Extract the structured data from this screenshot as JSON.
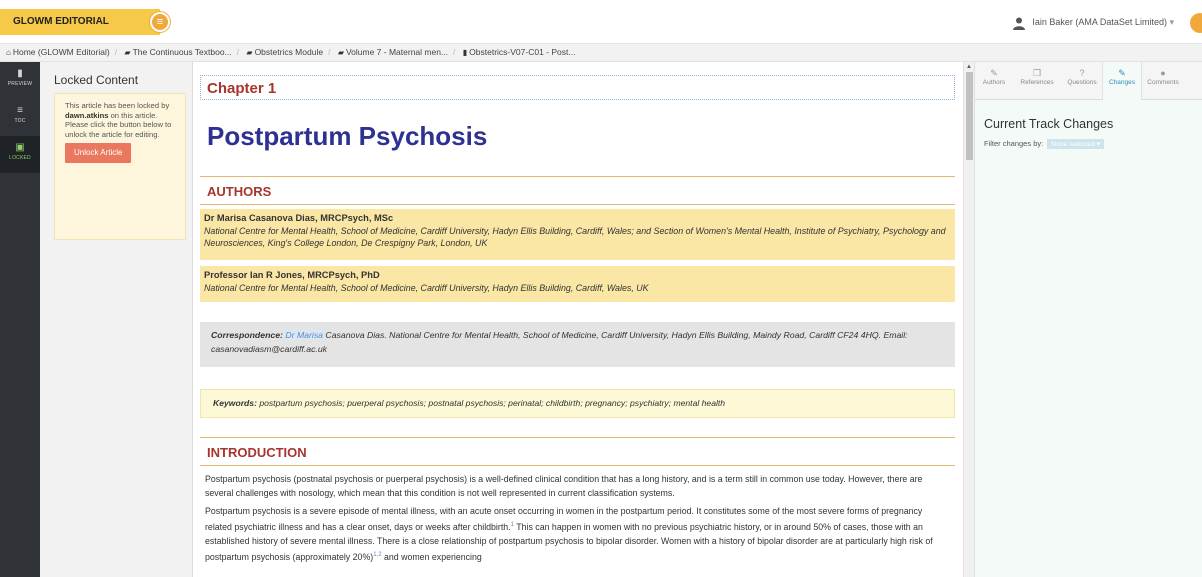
{
  "header": {
    "brand": "GLOWM EDITORIAL",
    "user": "Iain Baker (AMA DataSet Limited)",
    "user_caret": "▾"
  },
  "breadcrumb": [
    {
      "icon": "home-icon",
      "label": "Home (GLOWM Editorial)"
    },
    {
      "icon": "folder-icon",
      "label": "The Continuous Textboo..."
    },
    {
      "icon": "folder-icon",
      "label": "Obstetrics Module"
    },
    {
      "icon": "folder-icon",
      "label": "Volume 7 - Maternal men..."
    },
    {
      "icon": "document-icon",
      "label": "Obstetrics-V07-C01 - Post..."
    }
  ],
  "leftnav": [
    {
      "label": "PREVIEW",
      "icon": "document-icon"
    },
    {
      "label": "TOC",
      "icon": "list-icon"
    },
    {
      "label": "LOCKED",
      "icon": "lock-icon"
    }
  ],
  "locked": {
    "title": "Locked Content",
    "line1": "This article has been locked by ",
    "user": "dawn.atkins",
    "line1_end": " on this article.",
    "line2": "Please click the button below to unlock the article for editing.",
    "button": "Unlock Article"
  },
  "article": {
    "chapter": "Chapter 1",
    "title": "Postpartum Psychosis",
    "authors_heading": "AUTHORS",
    "authors": [
      {
        "name": "Dr Marisa Casanova Dias, MRCPsych, MSc",
        "affiliation": "National Centre for Mental Health, School of Medicine, Cardiff University, Hadyn Ellis Building, Cardiff, Wales; and Section of Women's Mental Health, Institute of Psychiatry, Psychology and Neurosciences, King's College London, De Crespigny Park, London, UK"
      },
      {
        "name": "Professor Ian R Jones, MRCPsych, PhD",
        "affiliation": "National Centre for Mental Health, School of Medicine, Cardiff University, Hadyn Ellis Building, Cardiff, Wales, UK"
      }
    ],
    "correspondence_label": "Correspondence:",
    "correspondence_highlight": "Dr Marisa",
    "correspondence_text": " Casanova Dias. National Centre for Mental Health, School of Medicine, Cardiff University, Hadyn Ellis Building, Maindy Road, Cardiff CF24 4HQ. Email: casanovadiasm@cardiff.ac.uk",
    "keywords_label": "Keywords:",
    "keywords": " postpartum psychosis; puerperal psychosis; postnatal psychosis; perinatal; childbirth; pregnancy; psychiatry; mental health",
    "intro_heading": "INTRODUCTION",
    "para1": "Postpartum psychosis (postnatal psychosis or puerperal psychosis) is a well-defined clinical condition that has a long history, and is a term still in common use today. However, there are several challenges with nosology, which mean that this condition is not well represented in current classification systems.",
    "para2_a": "Postpartum psychosis is a severe episode of mental illness, with an acute onset occurring in women in the postpartum period. It constitutes some of the most severe forms of pregnancy related psychiatric illness and has a clear onset, days or weeks after childbirth.",
    "para2_ref1": "1",
    "para2_b": " This can happen in women with no previous psychiatric history, or in around 50% of cases, those with an established history of severe mental illness. There is a close relationship of postpartum psychosis to bipolar disorder. Women with a history of bipolar disorder are at particularly high risk of postpartum psychosis (approximately 20%)",
    "para2_ref2": "1,2",
    "para2_c": " and women experiencing"
  },
  "rightpanel": {
    "tabs": [
      {
        "label": "Authors",
        "icon": "authors-icon",
        "glyph": "✎"
      },
      {
        "label": "References",
        "icon": "references-icon",
        "glyph": "❐"
      },
      {
        "label": "Questions",
        "icon": "question-icon",
        "glyph": "?"
      },
      {
        "label": "Changes",
        "icon": "changes-icon",
        "glyph": "✎"
      },
      {
        "label": "Comments",
        "icon": "comments-icon",
        "glyph": "●"
      }
    ],
    "title": "Current Track Changes",
    "filter_label": "Filter changes by:",
    "filter_value": "None selected ▾"
  },
  "colors": {
    "brand": "#f7c948",
    "heading": "#a6352e",
    "title": "#2e3192",
    "unlock": "#e9785f",
    "active_tab": "#2a8fb8"
  }
}
